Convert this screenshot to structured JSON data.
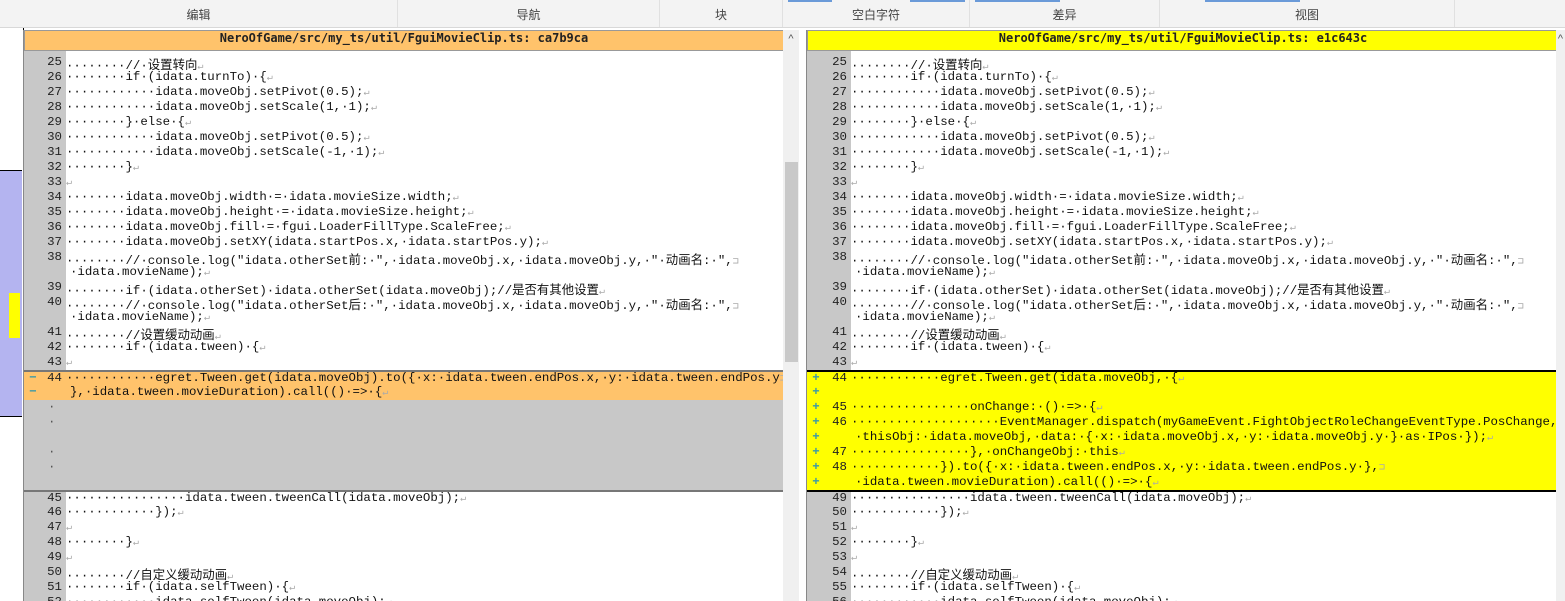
{
  "toolbar": {
    "groups": [
      "编辑",
      "导航",
      "块",
      "空白字符",
      "差异",
      "视图"
    ]
  },
  "colors": {
    "removed": "#ffc36b",
    "added": "#ffff00",
    "gutter": "#c8c8c8",
    "overview": "#b4b4f0"
  },
  "left": {
    "title": "NeroOfGame/src/my_ts/util/FguiMovieClip.ts: ca7b9ca",
    "rows": [
      {
        "n": "25",
        "t": "········//·设置转向"
      },
      {
        "n": "26",
        "t": "········if·(idata.turnTo)·{"
      },
      {
        "n": "27",
        "t": "············idata.moveObj.setPivot(0.5);"
      },
      {
        "n": "28",
        "t": "············idata.moveObj.setScale(1,·1);"
      },
      {
        "n": "29",
        "t": "········}·else·{"
      },
      {
        "n": "30",
        "t": "············idata.moveObj.setPivot(0.5);"
      },
      {
        "n": "31",
        "t": "············idata.moveObj.setScale(-1,·1);"
      },
      {
        "n": "32",
        "t": "········}"
      },
      {
        "n": "33",
        "t": ""
      },
      {
        "n": "34",
        "t": "········idata.moveObj.width·=·idata.movieSize.width;"
      },
      {
        "n": "35",
        "t": "········idata.moveObj.height·=·idata.movieSize.height;"
      },
      {
        "n": "36",
        "t": "········idata.moveObj.fill·=·fgui.LoaderFillType.ScaleFree;"
      },
      {
        "n": "37",
        "t": "········idata.moveObj.setXY(idata.startPos.x,·idata.startPos.y);"
      },
      {
        "n": "38",
        "t": "········//·console.log(\"idata.otherSet前:·\",·idata.moveObj.x,·idata.moveObj.y,·\"·动画名:·\",",
        "w": 1
      },
      {
        "n": "",
        "t": "·idata.movieName);",
        "c": 1
      },
      {
        "n": "39",
        "t": "········if·(idata.otherSet)·idata.otherSet(idata.moveObj);//是否有其他设置"
      },
      {
        "n": "40",
        "t": "········//·console.log(\"idata.otherSet后:·\",·idata.moveObj.x,·idata.moveObj.y,·\"·动画名:·\",",
        "w": 1
      },
      {
        "n": "",
        "t": "·idata.movieName);",
        "c": 1
      },
      {
        "n": "41",
        "t": "········//设置缓动动画"
      },
      {
        "n": "42",
        "t": "········if·(idata.tween)·{"
      },
      {
        "n": "43",
        "t": ""
      },
      {
        "n": "44",
        "t": "············egret.Tween.get(idata.moveObj).to({·x:·idata.tween.endPos.x,·y:·idata.tween.endPos.y",
        "w": 1,
        "k": "del",
        "m": "−"
      },
      {
        "n": "",
        "t": "},·idata.tween.movieDuration).call(()·=>·{",
        "c": 1,
        "k": "del",
        "m": "−"
      },
      {
        "k": "fill",
        "d": "·"
      },
      {
        "k": "fill",
        "d": "·"
      },
      {
        "k": "fill"
      },
      {
        "k": "fill",
        "d": "·"
      },
      {
        "k": "fill",
        "d": "·"
      },
      {
        "k": "fill"
      },
      {
        "n": "45",
        "t": "················idata.tween.tweenCall(idata.moveObj);"
      },
      {
        "n": "46",
        "t": "············});"
      },
      {
        "n": "47",
        "t": ""
      },
      {
        "n": "48",
        "t": "········}"
      },
      {
        "n": "49",
        "t": ""
      },
      {
        "n": "50",
        "t": "········//自定义缓动动画"
      },
      {
        "n": "51",
        "t": "········if·(idata.selfTween)·{"
      },
      {
        "n": "52",
        "t": "············idata.selfTween(idata.moveObj);"
      }
    ]
  },
  "right": {
    "title": "NeroOfGame/src/my_ts/util/FguiMovieClip.ts: e1c643c",
    "rows": [
      {
        "n": "25",
        "t": "········//·设置转向"
      },
      {
        "n": "26",
        "t": "········if·(idata.turnTo)·{"
      },
      {
        "n": "27",
        "t": "············idata.moveObj.setPivot(0.5);"
      },
      {
        "n": "28",
        "t": "············idata.moveObj.setScale(1,·1);"
      },
      {
        "n": "29",
        "t": "········}·else·{"
      },
      {
        "n": "30",
        "t": "············idata.moveObj.setPivot(0.5);"
      },
      {
        "n": "31",
        "t": "············idata.moveObj.setScale(-1,·1);"
      },
      {
        "n": "32",
        "t": "········}"
      },
      {
        "n": "33",
        "t": ""
      },
      {
        "n": "34",
        "t": "········idata.moveObj.width·=·idata.movieSize.width;"
      },
      {
        "n": "35",
        "t": "········idata.moveObj.height·=·idata.movieSize.height;"
      },
      {
        "n": "36",
        "t": "········idata.moveObj.fill·=·fgui.LoaderFillType.ScaleFree;"
      },
      {
        "n": "37",
        "t": "········idata.moveObj.setXY(idata.startPos.x,·idata.startPos.y);"
      },
      {
        "n": "38",
        "t": "········//·console.log(\"idata.otherSet前:·\",·idata.moveObj.x,·idata.moveObj.y,·\"·动画名:·\",",
        "w": 1
      },
      {
        "n": "",
        "t": "·idata.movieName);",
        "c": 1
      },
      {
        "n": "39",
        "t": "········if·(idata.otherSet)·idata.otherSet(idata.moveObj);//是否有其他设置"
      },
      {
        "n": "40",
        "t": "········//·console.log(\"idata.otherSet后:·\",·idata.moveObj.x,·idata.moveObj.y,·\"·动画名:·\",",
        "w": 1
      },
      {
        "n": "",
        "t": "·idata.movieName);",
        "c": 1
      },
      {
        "n": "41",
        "t": "········//设置缓动动画"
      },
      {
        "n": "42",
        "t": "········if·(idata.tween)·{"
      },
      {
        "n": "43",
        "t": ""
      },
      {
        "n": "44",
        "t": "············egret.Tween.get(idata.moveObj,·{",
        "k": "add",
        "m": "+"
      },
      {
        "n": "",
        "t": "",
        "k": "add",
        "m": "+",
        "e": 1
      },
      {
        "n": "45",
        "t": "················onChange:·()·=>·{",
        "k": "add",
        "m": "+"
      },
      {
        "n": "46",
        "t": "····················EventManager.dispatch(myGameEvent.FightObjectRoleChangeEventType.PosChange,·{",
        "w": 1,
        "k": "add",
        "m": "+"
      },
      {
        "n": "",
        "t": "·thisObj:·idata.moveObj,·data:·{·x:·idata.moveObj.x,·y:·idata.moveObj.y·}·as·IPos·});",
        "c": 1,
        "k": "add",
        "m": "+"
      },
      {
        "n": "47",
        "t": "················},·onChangeObj:·this",
        "k": "add",
        "m": "+"
      },
      {
        "n": "48",
        "t": "············}).to({·x:·idata.tween.endPos.x,·y:·idata.tween.endPos.y·},",
        "w": 1,
        "k": "add",
        "m": "+"
      },
      {
        "n": "",
        "t": "·idata.tween.movieDuration).call(()·=>·{",
        "c": 1,
        "k": "add",
        "m": "+"
      },
      {
        "n": "49",
        "t": "················idata.tween.tweenCall(idata.moveObj);"
      },
      {
        "n": "50",
        "t": "············});"
      },
      {
        "n": "51",
        "t": ""
      },
      {
        "n": "52",
        "t": "········}"
      },
      {
        "n": "53",
        "t": ""
      },
      {
        "n": "54",
        "t": "········//自定义缓动动画"
      },
      {
        "n": "55",
        "t": "········if·(idata.selfTween)·{"
      },
      {
        "n": "56",
        "t": "············idata.selfTween(idata.moveObj);"
      }
    ]
  }
}
